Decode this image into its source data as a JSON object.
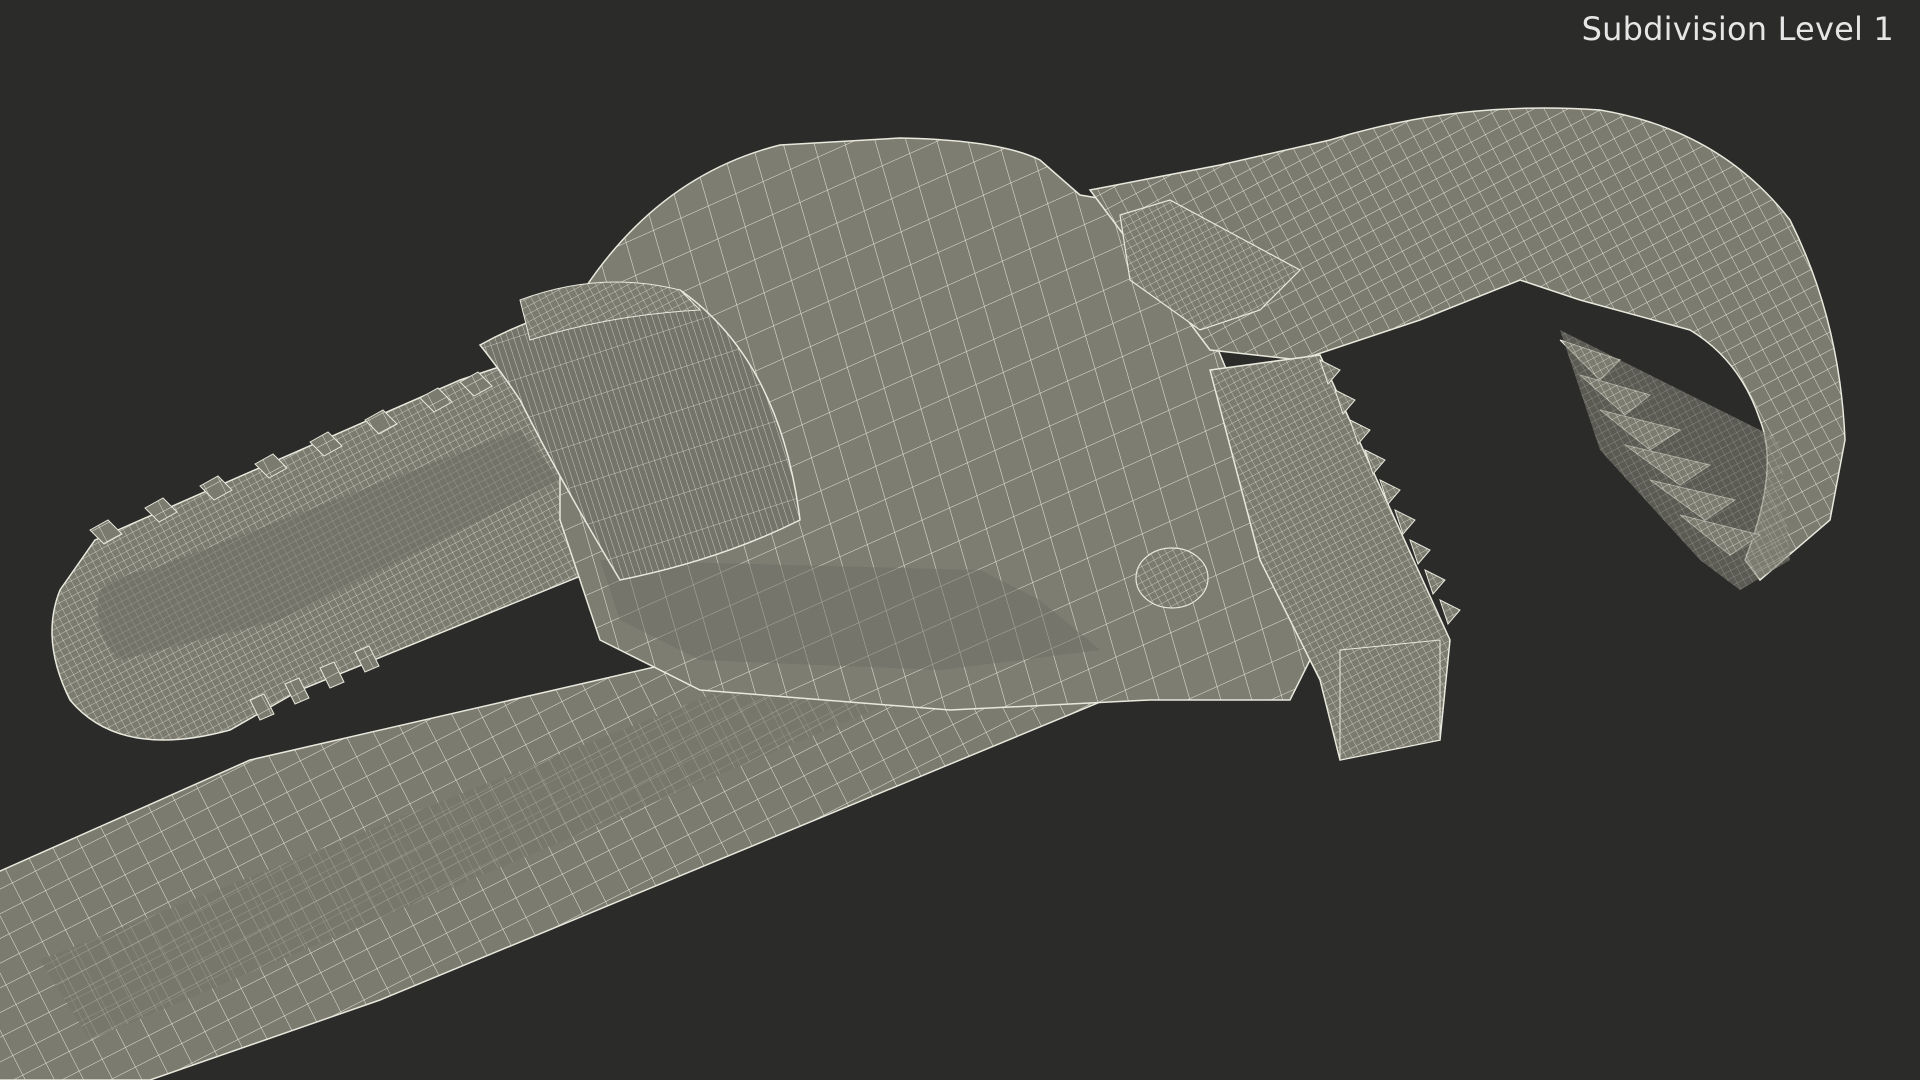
{
  "render": {
    "label": "Subdivision Level 1",
    "subject": "pipe-wrench-wireframe",
    "colors": {
      "background": "#2b2b2a",
      "mesh_fill": "#7b7b70",
      "mesh_fill_dark": "#5e5e55",
      "wire": "#f0f0e4",
      "label_text": "#e6e6e6"
    }
  }
}
